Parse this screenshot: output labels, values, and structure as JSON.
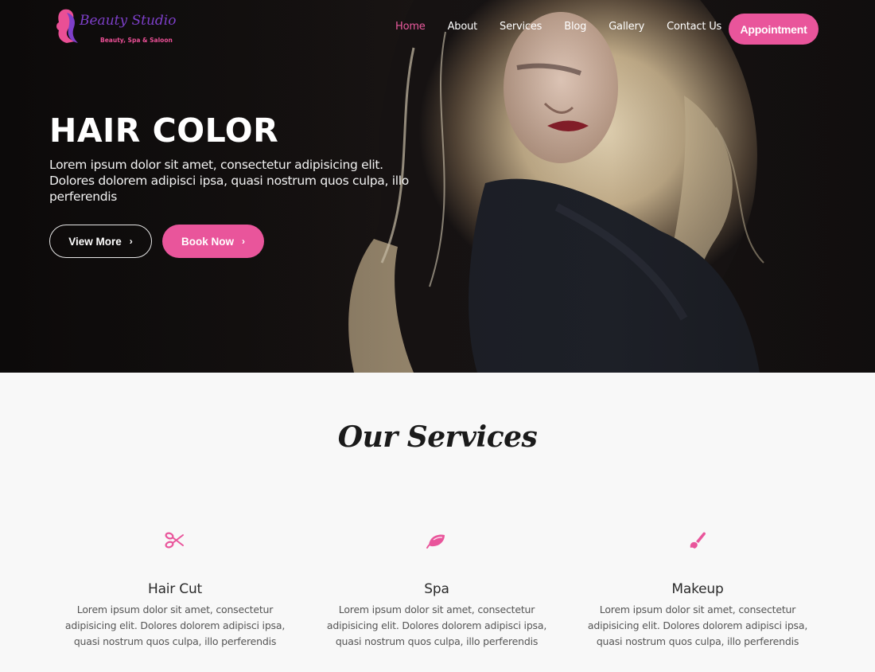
{
  "brand": {
    "name": "Beauty Studio",
    "tagline": "Beauty, Spa & Saloon",
    "logo_icon": "woman-silhouette-icon"
  },
  "nav": {
    "items": [
      {
        "label": "Home",
        "active": true
      },
      {
        "label": "About",
        "active": false
      },
      {
        "label": "Services",
        "active": false
      },
      {
        "label": "Blog",
        "active": false
      },
      {
        "label": "Gallery",
        "active": false
      },
      {
        "label": "Contact Us",
        "active": false
      }
    ],
    "cta_label": "Appointment"
  },
  "hero": {
    "title": "HAIR COLOR",
    "text": "Lorem ipsum dolor sit amet, consectetur adipisicing elit. Dolores dolorem adipisci ipsa, quasi nostrum quos culpa, illo perferendis",
    "primary_button": "View More",
    "secondary_button": "Book Now",
    "chevron": "›",
    "image_subject": "woman with long blonde hair"
  },
  "services": {
    "title": "Our Services",
    "items": [
      {
        "name": "Hair Cut",
        "icon": "scissors-icon",
        "description": "Lorem ipsum dolor sit amet, consectetur adipisicing elit. Dolores dolorem adipisci ipsa, quasi nostrum quos culpa, illo perferendis"
      },
      {
        "name": "Spa",
        "icon": "leaf-icon",
        "description": "Lorem ipsum dolor sit amet, consectetur adipisicing elit. Dolores dolorem adipisci ipsa, quasi nostrum quos culpa, illo perferendis"
      },
      {
        "name": "Makeup",
        "icon": "brush-icon",
        "description": "Lorem ipsum dolor sit amet, consectetur adipisicing elit. Dolores dolorem adipisci ipsa, quasi nostrum quos culpa, illo perferendis"
      }
    ]
  },
  "colors": {
    "accent": "#e9559b",
    "brand_purple": "#7d3fc9",
    "hero_dark": "#121010",
    "section_bg": "#f8f8f8"
  }
}
